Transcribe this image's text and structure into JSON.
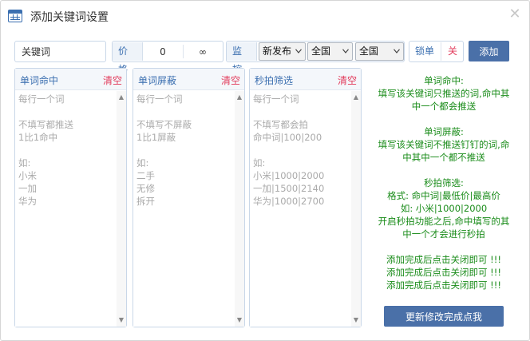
{
  "window": {
    "title": "添加关键词设置",
    "close_icon": "close-icon"
  },
  "toolbar": {
    "keyword_placeholder": "关键词",
    "price_label": "价格",
    "price_min": "0",
    "price_max": "∞",
    "monitor_label": "监控",
    "select_type": "新发布",
    "select_region_1": "全国",
    "select_region_2": "全国",
    "lock_label": "锁单",
    "lock_value": "关",
    "add_label": "添加"
  },
  "panels": [
    {
      "title": "单词命中",
      "clear_label": "清空",
      "placeholder": "每行一个词\n\n不填写都推送\n1比1命中\n\n如:\n小米\n一加\n华为"
    },
    {
      "title": "单词屏蔽",
      "clear_label": "清空",
      "placeholder": "每行一个词\n\n不填写不屏蔽\n1比1屏蔽\n\n如:\n二手\n无修\n拆开"
    },
    {
      "title": "秒拍筛选",
      "clear_label": "清空",
      "placeholder": "每行一个词\n\n不填写都会拍\n命中词|100|200\n\n如:\n小米|1000|2000\n一加|1500|2140\n华为|1000|2700"
    }
  ],
  "help": {
    "lines_1": [
      "单词命中:",
      "填写该关键词只推送的词,命中其",
      "中一个都会推送"
    ],
    "lines_2": [
      "单词屏蔽:",
      "填写该关键词不推送钉钉的词,命",
      "中其中一个都不推送"
    ],
    "lines_3": [
      "秒拍筛选:",
      "格式: 命中词|最低价|最高价",
      "如: 小米|1000|2000",
      "开启秒拍功能之后,命中填写的其",
      "中一个才会进行秒拍"
    ],
    "lines_4": [
      "添加完成后点击关闭即可 !!!",
      "添加完成后点击关闭即可 !!!",
      "添加完成后点击关闭即可 !!!"
    ],
    "done_label": "更新修改完成点我",
    "color": "#1a8c1a"
  },
  "colors": {
    "accent": "#4a70a8",
    "label_blue": "#3b6fb0",
    "clear_red": "#e23b5b"
  }
}
